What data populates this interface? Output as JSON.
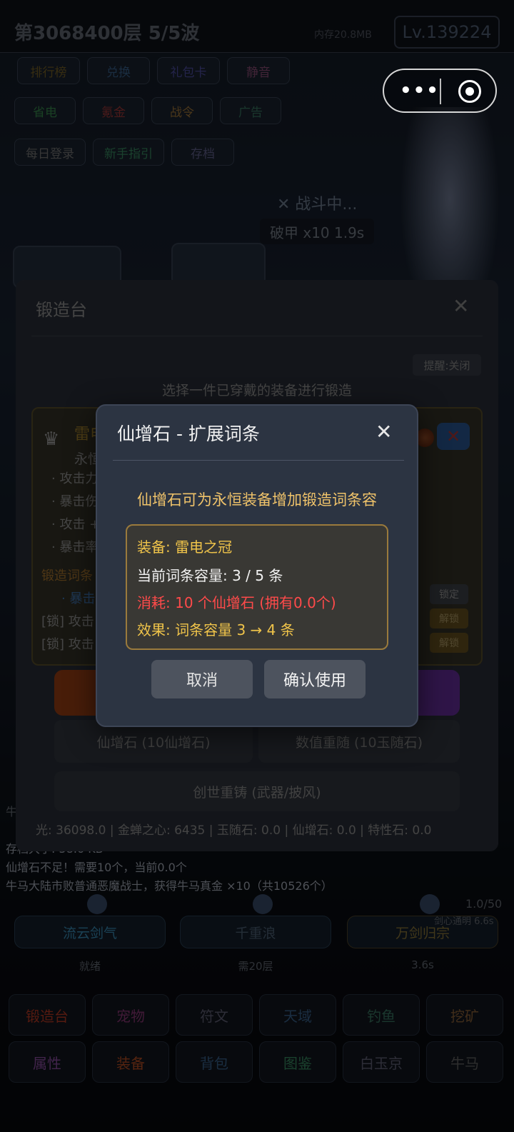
{
  "colors": {
    "accent_gold": "#f0c36a",
    "danger_red": "#ff4a4a",
    "equip_yellow": "#f0c44a",
    "modal_bg": "#2c3442",
    "panel_bg": "#3b414d"
  },
  "header": {
    "floor": "第3068400层  5/5波",
    "memory": "内存20.8MB",
    "level": "Lv.139224"
  },
  "capsule": {
    "more_icon": "more-dots-icon",
    "close_icon": "target-icon"
  },
  "top_buttons": {
    "row1": [
      {
        "label": "排行榜",
        "color": "#5a4a1c"
      },
      {
        "label": "兑换",
        "color": "#2a4a6a"
      },
      {
        "label": "礼包卡",
        "color": "#3a3a7a"
      },
      {
        "label": "静音",
        "color": "#6a3a5a"
      }
    ],
    "row2": [
      {
        "label": "省电",
        "color": "#2a6a3a"
      },
      {
        "label": "氪金",
        "color": "#7a2a2a"
      },
      {
        "label": "战令",
        "color": "#7a5a2a"
      },
      {
        "label": "广告",
        "color": "#2a5a4a"
      }
    ],
    "row3": [
      {
        "label": "每日登录",
        "color": "#5a5a5a"
      },
      {
        "label": "新手指引",
        "color": "#2a6a4a"
      },
      {
        "label": "存档",
        "color": "#4a4a6a"
      }
    ]
  },
  "battle": {
    "status": "✕ 战斗中...",
    "debuff": "破甲 x10 1.9s"
  },
  "forge": {
    "title": "锻造台",
    "remind_button": "提醒:关闭",
    "select_tip": "选择一件已穿戴的装备进行锻造",
    "item": {
      "name": "雷电",
      "subtitle": "永恒",
      "stats": [
        "· 攻击力",
        "· 暴击伤",
        "· 攻击 +",
        "· 暴击率"
      ],
      "affix_title": "锻造词条",
      "affix_blue": "· 暴击伤",
      "locked_lines": [
        "[锁] 攻击",
        "[锁] 攻击"
      ],
      "lock_label": "锁定",
      "unlock_label": "解锁"
    },
    "xian_button": "仙增石 (10仙增石)",
    "reroll_button": "数值重随 (10玉随石)",
    "genesis_button": "创世重铸 (武器/披风)",
    "resources": "光: 36098.0  |  金蝉之心: 6435  |  玉随石: 0.0  |  仙增石: 0.0  |  特性石: 0.0"
  },
  "log": {
    "lines": [
      "牛",
      "存档大小: 58.6 KB",
      "仙增石不足！需要10个，当前0.0个",
      "牛马大陆市败普通恶魔战士，获得牛马真金 ×10（共10526个）"
    ]
  },
  "skills": [
    {
      "label": "流云剑气",
      "foot": "就绪",
      "color": "#2a6a8a"
    },
    {
      "label": "千重浪",
      "foot": "需20层",
      "color": "#3a4a5a"
    },
    {
      "label": "万剑归宗",
      "foot": "3.6s",
      "color": "#6a5a2a"
    }
  ],
  "skill_status": {
    "count": "1.0/50",
    "state": "剑心通明 6.6s"
  },
  "nav": [
    {
      "label": "锻造台",
      "color": "#8a2a1a"
    },
    {
      "label": "宠物",
      "color": "#6a2a5a"
    },
    {
      "label": "符文",
      "color": "#4a4a5a"
    },
    {
      "label": "天域",
      "color": "#2a4a6a"
    },
    {
      "label": "钓鱼",
      "color": "#2a5a4a"
    },
    {
      "label": "挖矿",
      "color": "#6a4a2a"
    },
    {
      "label": "属性",
      "color": "#6a3a7a"
    },
    {
      "label": "装备",
      "color": "#8a3a1a"
    },
    {
      "label": "背包",
      "color": "#2a4a6a"
    },
    {
      "label": "图鉴",
      "color": "#2a6a4a"
    },
    {
      "label": "白玉京",
      "color": "#4a4a5a"
    },
    {
      "label": "牛马",
      "color": "#4a4a4a"
    }
  ],
  "modal": {
    "title": "仙增石 - 扩展词条",
    "description": "仙增石可为永恒装备增加锻造词条容",
    "equip_line": "装备: 雷电之冠",
    "capacity_line": "当前词条容量: 3 / 5 条",
    "cost_line": "消耗: 10 个仙增石 (拥有0.0个)",
    "effect_line": "效果: 词条容量 3 → 4 条",
    "cancel_label": "取消",
    "confirm_label": "确认使用"
  }
}
